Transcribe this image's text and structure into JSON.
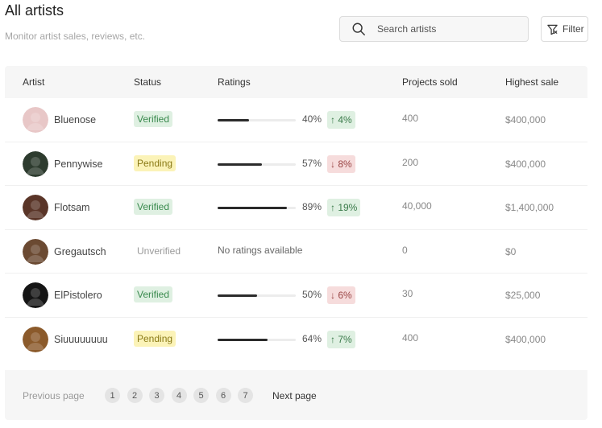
{
  "header": {
    "title": "All artists",
    "subtitle": "Monitor artist sales, reviews, etc."
  },
  "search": {
    "placeholder": "Search artists",
    "icon": "search-icon"
  },
  "filter": {
    "label": "Filter",
    "icon": "filter-icon"
  },
  "table": {
    "columns": [
      "Artist",
      "Status",
      "Ratings",
      "Projects sold",
      "Highest sale"
    ],
    "rows": [
      {
        "artist": "Bluenose",
        "status": "Verified",
        "status_type": "verified",
        "rating": 40,
        "rating_label": "40%",
        "delta": "↑ 4%",
        "delta_dir": "up",
        "projects_sold": "400",
        "highest_sale": "$400,000",
        "avatar_color": "#e8c7c7"
      },
      {
        "artist": "Pennywise",
        "status": "Pending",
        "status_type": "pending",
        "rating": 57,
        "rating_label": "57%",
        "delta": "↓ 8%",
        "delta_dir": "down",
        "projects_sold": "200",
        "highest_sale": "$400,000",
        "avatar_color": "#2d3b2e"
      },
      {
        "artist": "Flotsam",
        "status": "Verified",
        "status_type": "verified",
        "rating": 89,
        "rating_label": "89%",
        "delta": "↑ 19%",
        "delta_dir": "up",
        "projects_sold": "40,000",
        "highest_sale": "$1,400,000",
        "avatar_color": "#5a3528"
      },
      {
        "artist": "Gregautsch",
        "status": "Unverified",
        "status_type": "unverified",
        "no_ratings": "No ratings available",
        "projects_sold": "0",
        "highest_sale": "$0",
        "avatar_color": "#6b4a32"
      },
      {
        "artist": "ElPistolero",
        "status": "Verified",
        "status_type": "verified",
        "rating": 50,
        "rating_label": "50%",
        "delta": "↓ 6%",
        "delta_dir": "down",
        "projects_sold": "30",
        "highest_sale": "$25,000",
        "avatar_color": "#151515"
      },
      {
        "artist": "Siuuuuuuuu",
        "status": "Pending",
        "status_type": "pending",
        "rating": 64,
        "rating_label": "64%",
        "delta": "↑ 7%",
        "delta_dir": "up",
        "projects_sold": "400",
        "highest_sale": "$400,000",
        "avatar_color": "#8b5a2b"
      }
    ]
  },
  "pagination": {
    "previous_label": "Previous page",
    "next_label": "Next page",
    "pages": [
      "1",
      "2",
      "3",
      "4",
      "5",
      "6",
      "7"
    ]
  }
}
